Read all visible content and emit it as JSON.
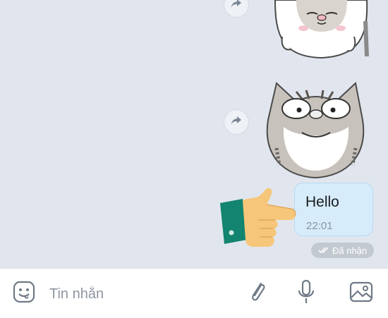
{
  "chat": {
    "messages": [
      {
        "type": "sticker",
        "sticker": "cat-sleepy-sticker"
      },
      {
        "type": "sticker",
        "sticker": "cat-surprised-sticker"
      },
      {
        "type": "text",
        "text": "Hello",
        "time": "22:01"
      }
    ],
    "status": {
      "icon": "double-check-icon",
      "label": "Đã nhận"
    }
  },
  "input_bar": {
    "placeholder": "Tin nhắn",
    "icons": [
      "emoji-icon",
      "attachment-icon",
      "microphone-icon",
      "image-icon"
    ]
  },
  "colors": {
    "chat_background": "#e1e6ee",
    "bubble": "#d6ecfb",
    "bubble_time": "#8a94a0",
    "status_badge": "#c3c9d1",
    "input_bar": "#ffffff",
    "icon": "#6f7a86"
  }
}
